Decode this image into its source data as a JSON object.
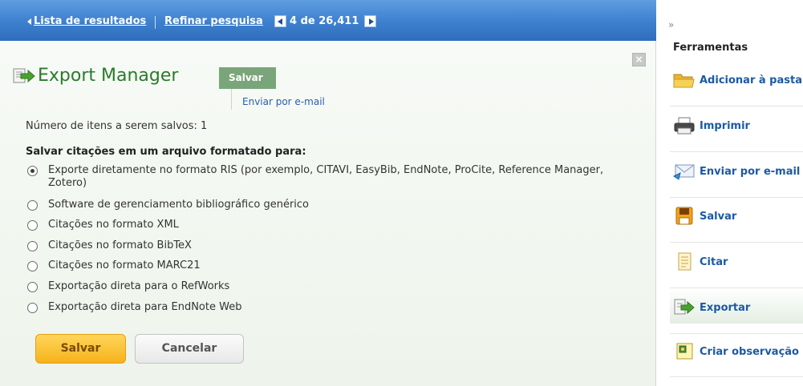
{
  "topbar": {
    "results_link": "Lista de resultados",
    "refine_link": "Refinar pesquisa",
    "counter": "4 de 26,411"
  },
  "export": {
    "title": "Export Manager",
    "tab_save": "Salvar",
    "tab_email": "Enviar por e-mail",
    "count_text": "Número de itens a serem salvos: 1",
    "heading": "Salvar citações em um arquivo formatado para:",
    "options": [
      {
        "label": "Exporte diretamente no formato RIS (por exemplo, CITAVI, EasyBib, EndNote, ProCite, Reference Manager, Zotero)",
        "selected": true
      },
      {
        "label": "Software de gerenciamento bibliográfico genérico",
        "selected": false
      },
      {
        "label": "Citações no formato XML",
        "selected": false
      },
      {
        "label": "Citações no formato BibTeX",
        "selected": false
      },
      {
        "label": "Citações no formato MARC21",
        "selected": false
      },
      {
        "label": "Exportação direta para o RefWorks",
        "selected": false
      },
      {
        "label": "Exportação direta para EndNote Web",
        "selected": false
      }
    ],
    "save_button": "Salvar",
    "cancel_button": "Cancelar"
  },
  "tools": {
    "collapse": "»",
    "title": "Ferramentas",
    "items": [
      {
        "label": "Adicionar à pasta",
        "icon": "folder-icon"
      },
      {
        "label": "Imprimir",
        "icon": "printer-icon"
      },
      {
        "label": "Enviar por e-mail",
        "icon": "email-icon"
      },
      {
        "label": "Salvar",
        "icon": "save-icon"
      },
      {
        "label": "Citar",
        "icon": "cite-icon"
      },
      {
        "label": "Exportar",
        "icon": "export-icon",
        "active": true
      },
      {
        "label": "Criar observação",
        "icon": "note-icon"
      }
    ]
  },
  "colors": {
    "topbar": "#3d7fcf",
    "title_green": "#2b7a2b",
    "link_blue": "#1a5aa5",
    "save_button": "#f6b21b"
  }
}
